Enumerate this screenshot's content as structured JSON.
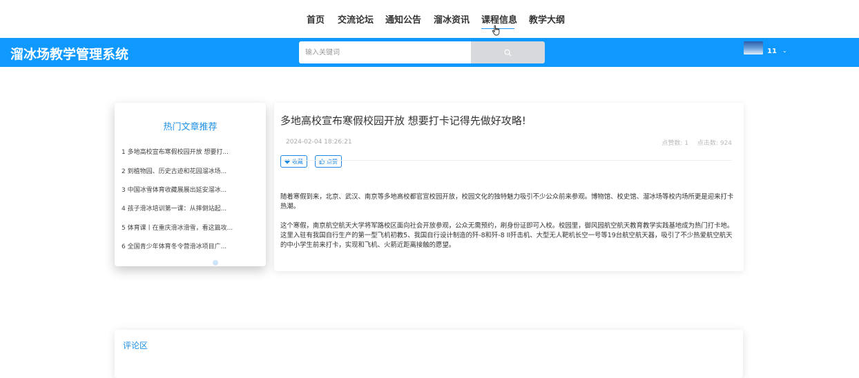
{
  "topnav": {
    "items": [
      "首页",
      "交流论坛",
      "通知公告",
      "溜冰资讯",
      "课程信息",
      "教学大纲"
    ],
    "active_index": 4
  },
  "header": {
    "brand": "溜冰场教学管理系统",
    "search_placeholder": "输入关键词",
    "username": "11",
    "caret": "⌄"
  },
  "sidebar": {
    "title": "热门文章推荐",
    "items": [
      "1  多地高校宣布寒假校园开放 想要打...",
      "2  到植物园、历史古迹和花园溜冰场...",
      "3  中国冰雪体育收藏展展出延安溜冰...",
      "4  孩子滑冰培训第一课：从摔倒站起...",
      "5  体育课丨在重庆滑冰滑雪，看这篇攻...",
      "6  全国青少年体育冬令营滑冰项目广..."
    ]
  },
  "article": {
    "title": "多地高校宣布寒假校园开放 想要打卡记得先做好攻略!",
    "date": "2024-02-04 18:26:21",
    "likes_label": "点赞数: 1",
    "views_label": "点击数: 924",
    "favorite_label": "收藏",
    "like_label": "点赞",
    "paragraphs": [
      "随着寒假到来，北京、武汉、南京等多地高校都官宣校园开放，校园文化的独特魅力吸引不少公众前来参观。博物馆、校史馆、溜冰场等校内场所更是迎来打卡热潮。",
      "这个寒假，南京航空航天大学将军路校区面向社会开放参观，公众无需预约，刷身份证即可入校。校园里，御风园航空航天教育教学实践基地成为热门打卡地。这里入驻有我国自行生产的第一型飞机初教5、我国自行设计制造的歼-8和歼-8 II歼击机、大型无人靶机长空一号等19台航空航天器，吸引了不少热爱航空航天的中小学生前来打卡，实现和飞机、火箭近距离接触的愿望。"
    ]
  },
  "comments": {
    "title": "评论区"
  },
  "colors": {
    "header_bg": "#0f98fd",
    "accent": "#1e90e6"
  }
}
